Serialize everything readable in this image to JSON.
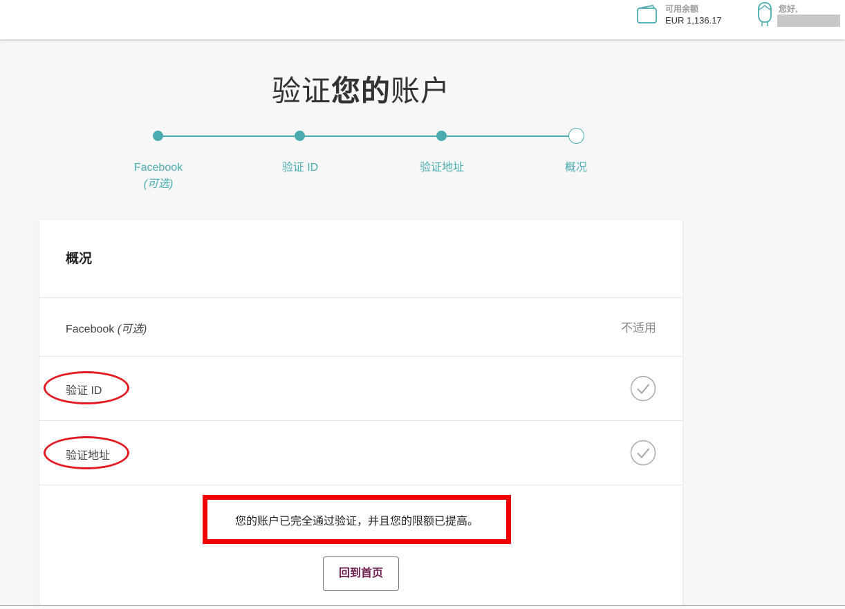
{
  "header": {
    "balance_label": "可用余额",
    "balance_value": "EUR 1,136.17",
    "greeting": "您好,",
    "wallet_icon": "wallet-icon",
    "user_icon": "user-avatar-icon"
  },
  "title": {
    "part1": "验证",
    "part2": "您的",
    "part3": "账户"
  },
  "steps": [
    {
      "label": "Facebook",
      "sublabel": "(可选)",
      "state": "done"
    },
    {
      "label": "验证 ID",
      "state": "done"
    },
    {
      "label": "验证地址",
      "state": "done"
    },
    {
      "label": "概况",
      "state": "current"
    }
  ],
  "summary": {
    "title": "概况",
    "rows": [
      {
        "label": "Facebook",
        "sublabel": "(可选)",
        "status": "不适用"
      },
      {
        "label": "验证 ID",
        "status_icon": "check-circle-icon"
      },
      {
        "label": "验证地址",
        "status_icon": "check-circle-icon"
      }
    ],
    "notice": "您的账户已完全通过验证，并且您的限额已提高。",
    "home_button": "回到首页"
  },
  "colors": {
    "accent": "#4aacb1",
    "button_text": "#6d1f4f",
    "annotation_red": "#ee0000"
  }
}
